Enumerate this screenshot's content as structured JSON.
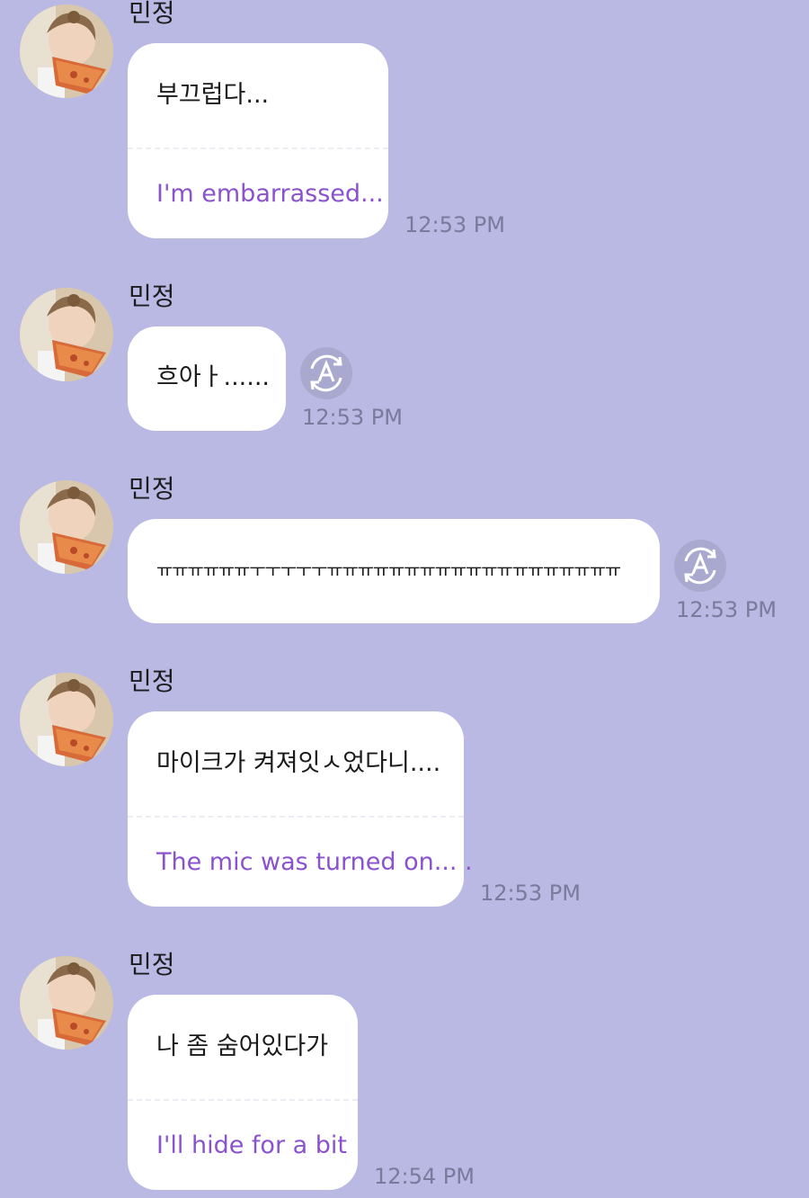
{
  "colors": {
    "background": "#b9b9e3",
    "bubble": "#ffffff",
    "translation_text": "#8a52cc",
    "timestamp_text": "#7a7a9c",
    "translate_button": "#a9a9cf"
  },
  "messages": [
    {
      "sender": "민정",
      "avatar": "child-eating-pizza-photo",
      "text": "부끄럽다...",
      "translation": "I'm embarrassed...",
      "time": "12:53 PM"
    },
    {
      "sender": "민정",
      "avatar": "child-eating-pizza-photo",
      "text": "흐아ㅏ......",
      "translate_icon": "auto-translate-icon",
      "time": "12:53 PM"
    },
    {
      "sender": "민정",
      "avatar": "child-eating-pizza-photo",
      "text": "ㅠㅠㅠㅠㅠㅠㅜㅜㅜㅜㅜㅠㅠㅠㅠㅠㅠㅠㅠㅠㅠㅠㅠㅠㅠㅠㅠㅠㅠㅠ",
      "translate_icon": "auto-translate-icon",
      "time": "12:53 PM"
    },
    {
      "sender": "민정",
      "avatar": "child-eating-pizza-photo",
      "text": "마이크가 켜져잇ㅅ었다니....",
      "translation": "The mic was turned on... .",
      "time": "12:53 PM"
    },
    {
      "sender": "민정",
      "avatar": "child-eating-pizza-photo",
      "text": "나 좀 숨어있다가",
      "translation": "I'll hide for a bit",
      "time": "12:54 PM"
    }
  ]
}
